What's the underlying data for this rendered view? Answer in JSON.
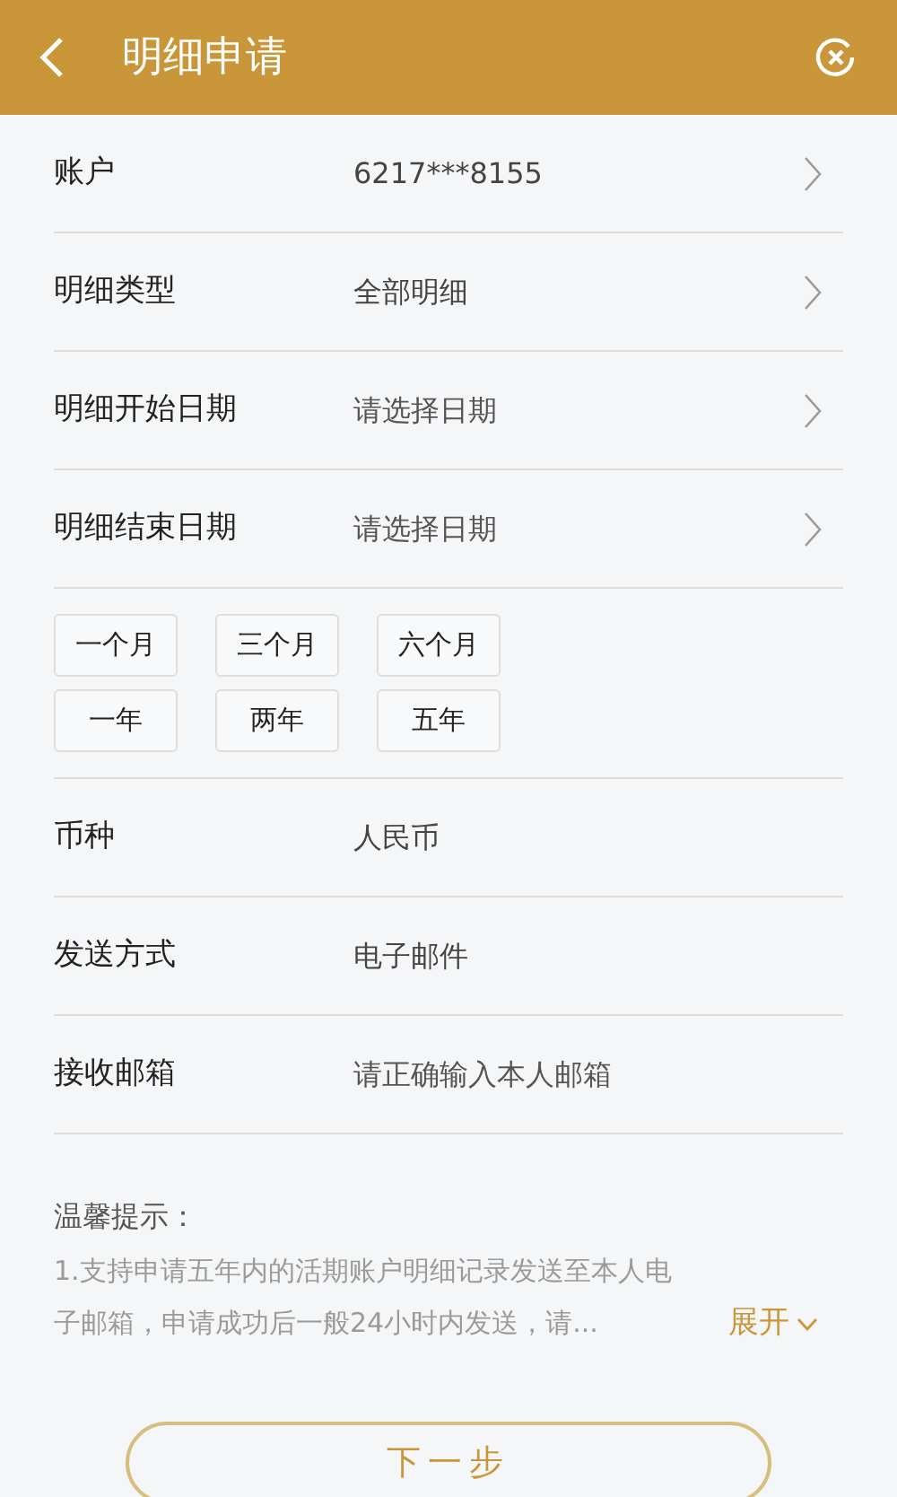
{
  "header": {
    "title": "明细申请"
  },
  "fields": [
    {
      "kind": "picker",
      "label": "账户",
      "value": "6217***8155"
    },
    {
      "kind": "picker",
      "label": "明细类型",
      "value": "全部明细"
    },
    {
      "kind": "picker",
      "label": "明细开始日期",
      "placeholder": "请选择日期"
    },
    {
      "kind": "picker",
      "label": "明细结束日期",
      "placeholder": "请选择日期"
    }
  ],
  "quick_ranges": [
    [
      "一个月",
      "三个月",
      "六个月"
    ],
    [
      "一年",
      "两年",
      "五年"
    ]
  ],
  "fields_2": [
    {
      "kind": "value",
      "label": "币种",
      "value": "人民币"
    },
    {
      "kind": "value",
      "label": "发送方式",
      "value": "电子邮件"
    },
    {
      "kind": "input",
      "label": "接收邮箱",
      "placeholder": "请正确输入本人邮箱"
    }
  ],
  "tips": {
    "title": "温馨提示：",
    "text": "1.支持申请五年内的活期账户明细记录发送至本人电子邮箱，申请成功后一般24小时内发送，请...",
    "expand": "展开"
  },
  "next_button": "下一步"
}
